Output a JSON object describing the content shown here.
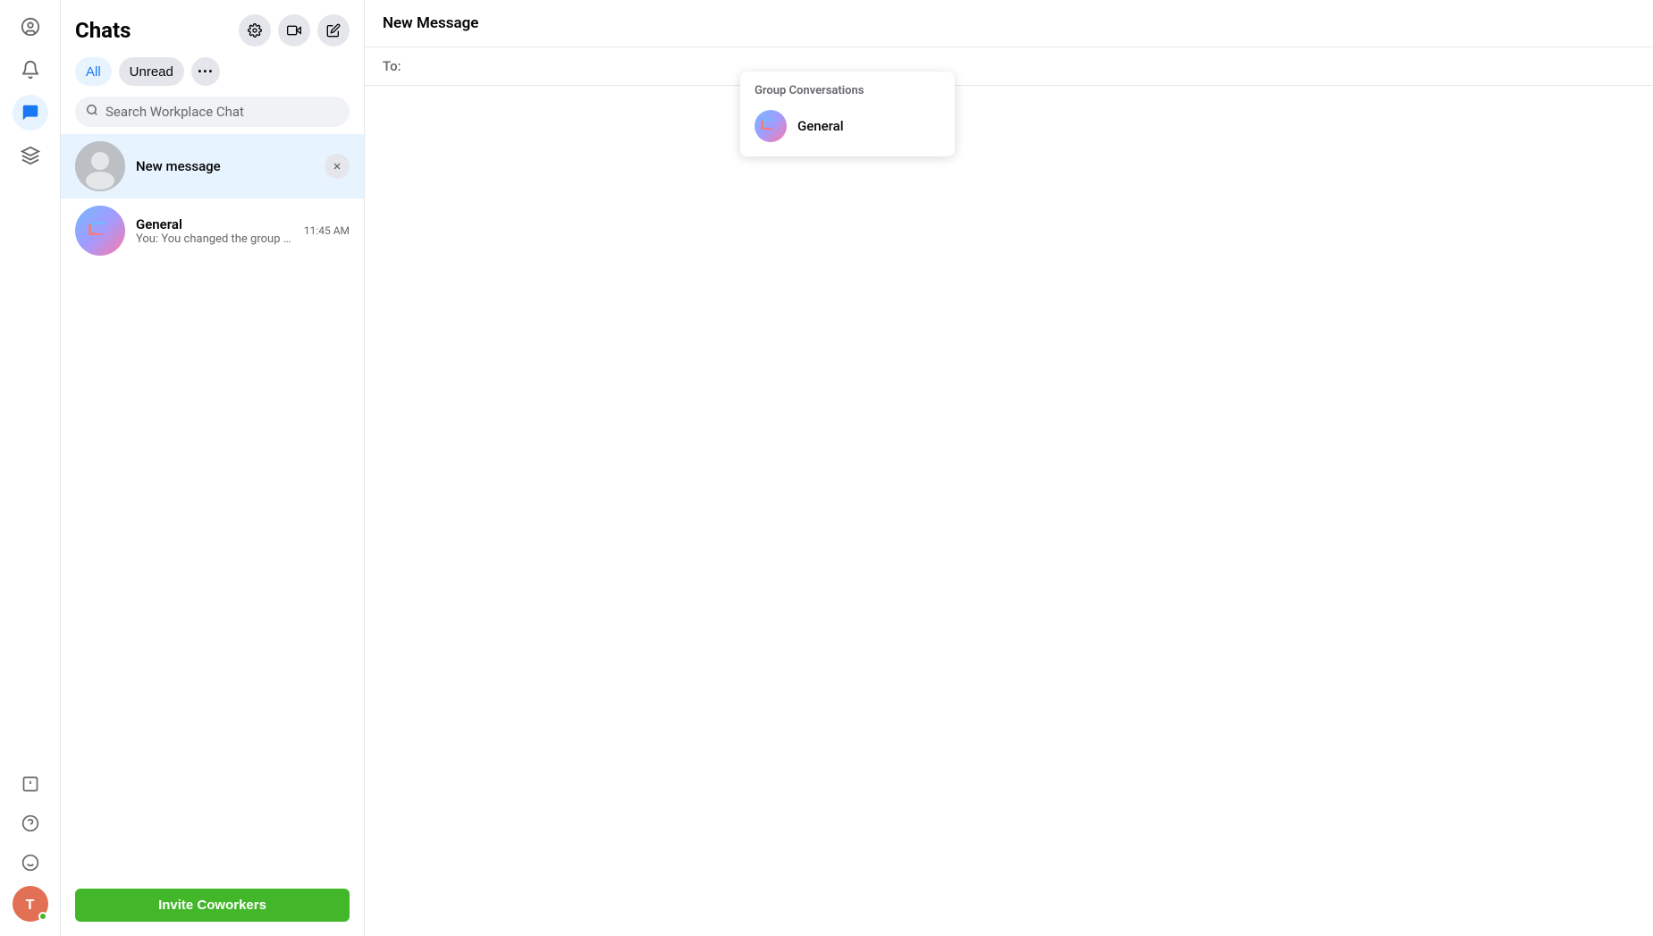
{
  "app": {
    "title": "Workplace Chat"
  },
  "sidebar": {
    "title": "Chats",
    "filter_tabs": [
      {
        "label": "All",
        "active": true
      },
      {
        "label": "Unread",
        "active": false
      }
    ],
    "more_label": "···",
    "search_placeholder": "Search Workplace Chat",
    "new_message_label": "New message",
    "invite_button_label": "Invite Coworkers"
  },
  "chat_list": [
    {
      "name": "General",
      "preview": "You: You changed the group photo.",
      "time": "11:45 AM",
      "is_group": true
    }
  ],
  "main": {
    "header": "New Message",
    "to_label": "To:",
    "to_placeholder": ""
  },
  "dropdown": {
    "section_title": "Group Conversations",
    "items": [
      {
        "name": "General",
        "is_group": true
      }
    ]
  },
  "nav": {
    "items": [
      {
        "icon": "⊙",
        "label": "home-icon"
      },
      {
        "icon": "🔔",
        "label": "notifications-icon"
      },
      {
        "icon": "💬",
        "label": "chat-icon",
        "active": true
      },
      {
        "icon": "✳",
        "label": "apps-icon"
      }
    ],
    "bottom": [
      {
        "icon": "!",
        "label": "feedback-icon"
      },
      {
        "icon": "?",
        "label": "help-icon"
      },
      {
        "icon": "☺",
        "label": "emoji-icon"
      }
    ],
    "avatar_letter": "T"
  }
}
